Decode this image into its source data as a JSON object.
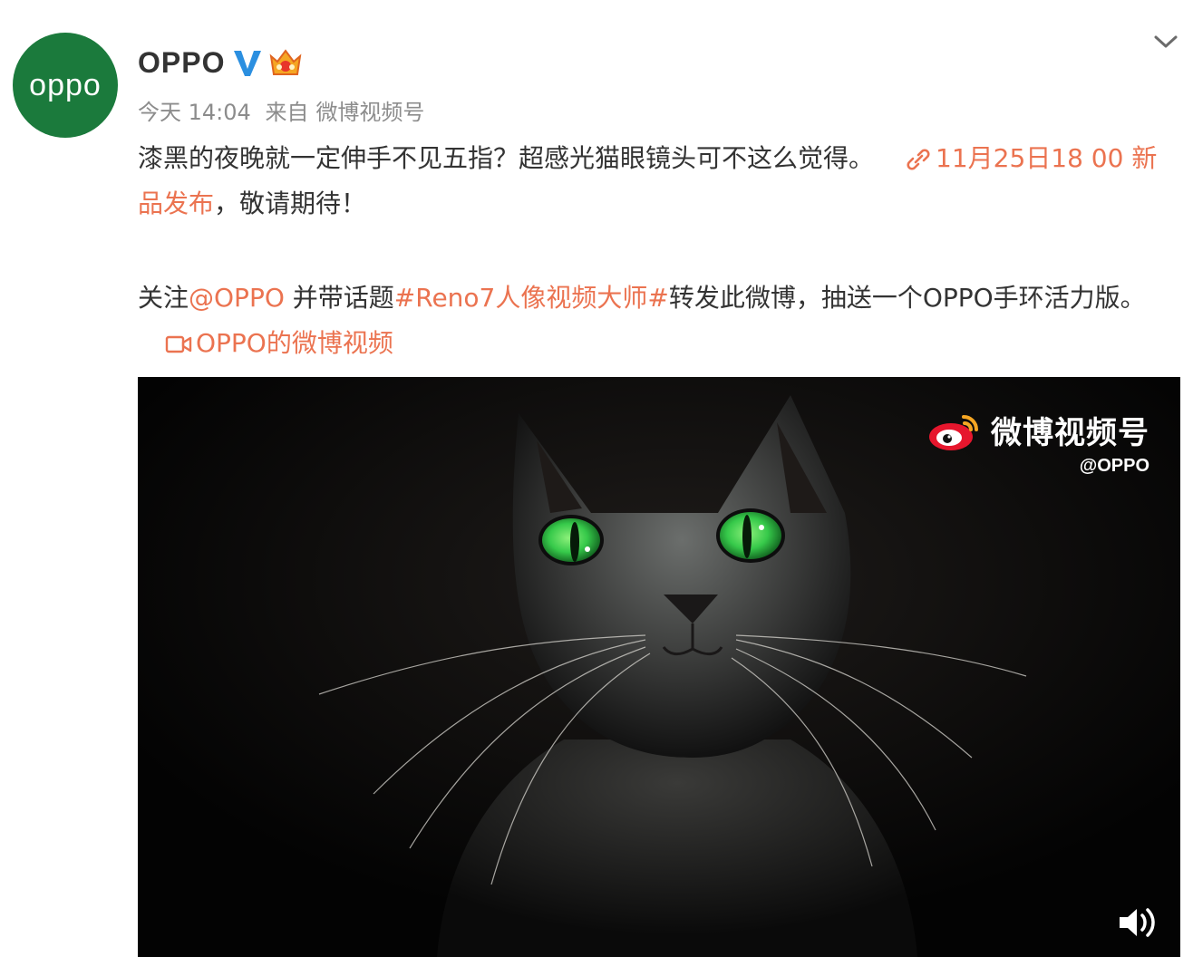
{
  "account": {
    "avatar_text": "oppo",
    "name": "OPPO"
  },
  "meta": {
    "time": "今天 14:04",
    "source_prefix": "来自",
    "source": "微博视频号"
  },
  "post": {
    "line1_text": "漆黑的夜晚就一定伸手不见五指？超感光猫眼镜头可不这么觉得。",
    "event_link": "11月25日18 00 新品发布",
    "line1_suffix": "，敬请期待！",
    "follow_prefix": "关注",
    "mention": "@OPPO",
    "topic_prefix": " 并带话题",
    "topic": "#Reno7人像视频大师#",
    "repost_text": "转发此微博，抽送一个OPPO手环活力版。",
    "video_link": "OPPO的微博视频"
  },
  "video": {
    "watermark_title": "微博视频号",
    "watermark_handle": "@OPPO"
  },
  "colors": {
    "link": "#eb7350",
    "avatar_bg": "#1b7a3c",
    "verified": "#2b8fe0",
    "eye": "#36c94a"
  },
  "icons": [
    "chevron-down-icon",
    "verified-icon",
    "vip-crown-icon",
    "link-icon",
    "video-icon",
    "weibo-logo-icon",
    "volume-icon"
  ]
}
